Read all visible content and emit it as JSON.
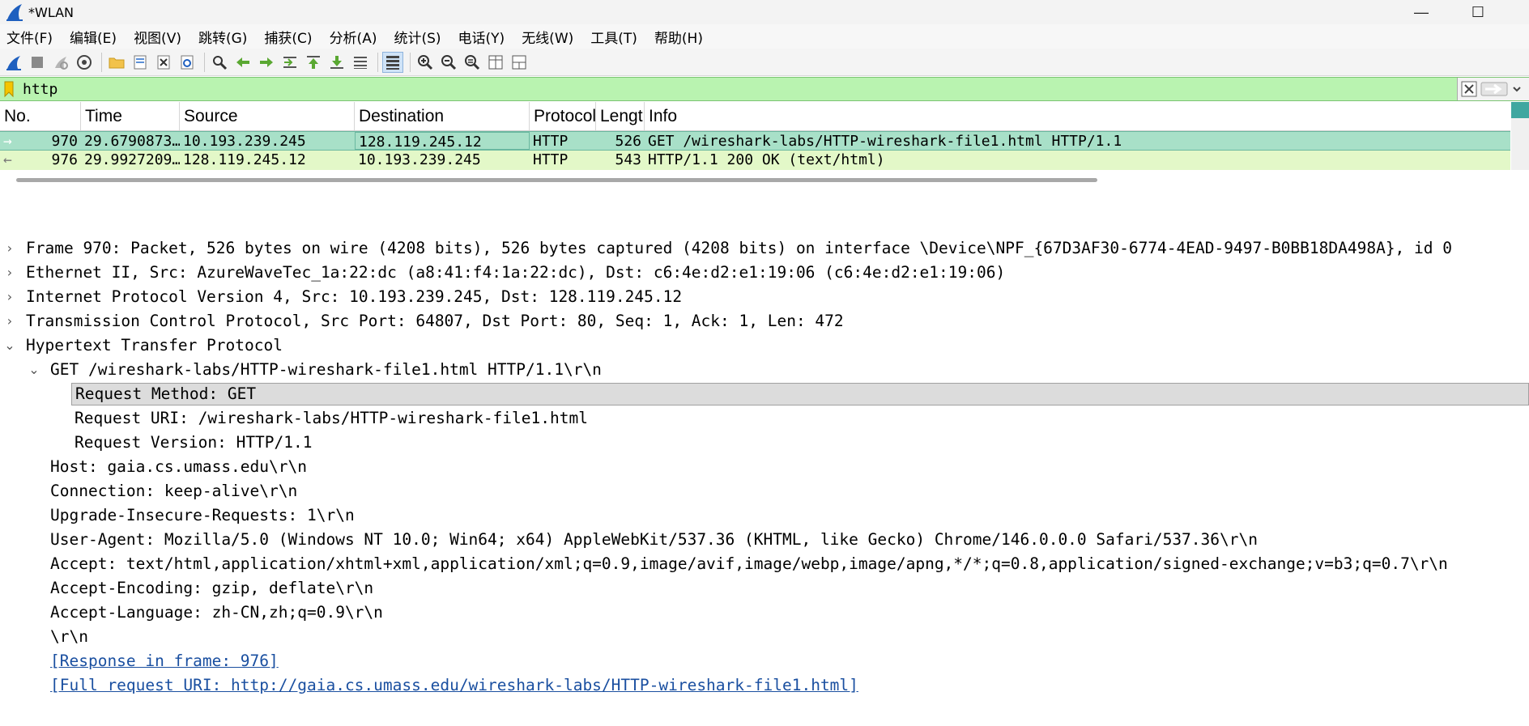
{
  "window": {
    "title": "*WLAN",
    "minimize_glyph": "—",
    "maximize_glyph": "☐"
  },
  "menu": [
    "文件(F)",
    "编辑(E)",
    "视图(V)",
    "跳转(G)",
    "捕获(C)",
    "分析(A)",
    "统计(S)",
    "电话(Y)",
    "无线(W)",
    "工具(T)",
    "帮助(H)"
  ],
  "toolbar": {
    "icons": [
      "shark-fin-start-icon",
      "stop-capture-icon",
      "restart-capture-icon",
      "capture-options-icon",
      "open-file-icon",
      "save-file-icon",
      "close-file-icon",
      "reload-file-icon",
      "find-packet-icon",
      "go-back-icon",
      "go-forward-icon",
      "go-to-packet-icon",
      "go-first-icon",
      "go-last-icon",
      "auto-scroll-icon",
      "colorize-icon",
      "zoom-in-icon",
      "zoom-out-icon",
      "zoom-normal-icon",
      "resize-columns-icon",
      "layout-icon"
    ]
  },
  "filter": {
    "value": "http",
    "bookmark_icon": "bookmark-icon",
    "clear_icon": "clear-icon",
    "apply_icon": "apply-arrow-icon",
    "dropdown_icon": "chevron-down-icon"
  },
  "packet_list": {
    "columns": [
      "No.",
      "Time",
      "Source",
      "Destination",
      "Protocol",
      "Lengt",
      "Info"
    ],
    "rows": [
      {
        "no": "970",
        "time": "29.6790873…",
        "source": "10.193.239.245",
        "destination": "128.119.245.12",
        "protocol": "HTTP",
        "length": "526",
        "info": "GET /wireshark-labs/HTTP-wireshark-file1.html HTTP/1.1",
        "direction": "→"
      },
      {
        "no": "976",
        "time": "29.9927209…",
        "source": "128.119.245.12",
        "destination": "10.193.239.245",
        "protocol": "HTTP",
        "length": "543",
        "info": "HTTP/1.1 200 OK  (text/html)",
        "direction": "←"
      }
    ]
  },
  "details": [
    {
      "text": "Frame 970: Packet, 526 bytes on wire (4208 bits), 526 bytes captured (4208 bits) on interface \\Device\\NPF_{67D3AF30-6774-4EAD-9497-B0BB18DA498A}, id 0",
      "chev": "›"
    },
    {
      "text": "Ethernet II, Src: AzureWaveTec_1a:22:dc (a8:41:f4:1a:22:dc), Dst: c6:4e:d2:e1:19:06 (c6:4e:d2:e1:19:06)",
      "chev": "›"
    },
    {
      "text": "Internet Protocol Version 4, Src: 10.193.239.245, Dst: 128.119.245.12",
      "chev": "›"
    },
    {
      "text": "Transmission Control Protocol, Src Port: 64807, Dst Port: 80, Seq: 1, Ack: 1, Len: 472",
      "chev": "›"
    },
    {
      "text": "Hypertext Transfer Protocol",
      "chev": "⌄"
    },
    {
      "text": "GET /wireshark-labs/HTTP-wireshark-file1.html HTTP/1.1\\r\\n",
      "chev": "⌄"
    },
    {
      "text": "Request Method: GET"
    },
    {
      "text": "Request URI: /wireshark-labs/HTTP-wireshark-file1.html"
    },
    {
      "text": "Request Version: HTTP/1.1"
    },
    {
      "text": "Host: gaia.cs.umass.edu\\r\\n"
    },
    {
      "text": "Connection: keep-alive\\r\\n"
    },
    {
      "text": "Upgrade-Insecure-Requests: 1\\r\\n"
    },
    {
      "text": "User-Agent: Mozilla/5.0 (Windows NT 10.0; Win64; x64) AppleWebKit/537.36 (KHTML, like Gecko) Chrome/146.0.0.0 Safari/537.36\\r\\n"
    },
    {
      "text": "Accept: text/html,application/xhtml+xml,application/xml;q=0.9,image/avif,image/webp,image/apng,*/*;q=0.8,application/signed-exchange;v=b3;q=0.7\\r\\n"
    },
    {
      "text": "Accept-Encoding: gzip, deflate\\r\\n"
    },
    {
      "text": "Accept-Language: zh-CN,zh;q=0.9\\r\\n"
    },
    {
      "text": "\\r\\n"
    },
    {
      "text": "[Response in frame: 976]"
    },
    {
      "text": "[Full request URI: http://gaia.cs.umass.edu/wireshark-labs/HTTP-wireshark-file1.html]"
    }
  ],
  "colors": {
    "filter_bg": "#b9f3b0",
    "selected_row": "#a8e0c8",
    "second_row": "#e3f8c8",
    "link": "#1a4fa0",
    "accent": "#1e5fbf"
  }
}
